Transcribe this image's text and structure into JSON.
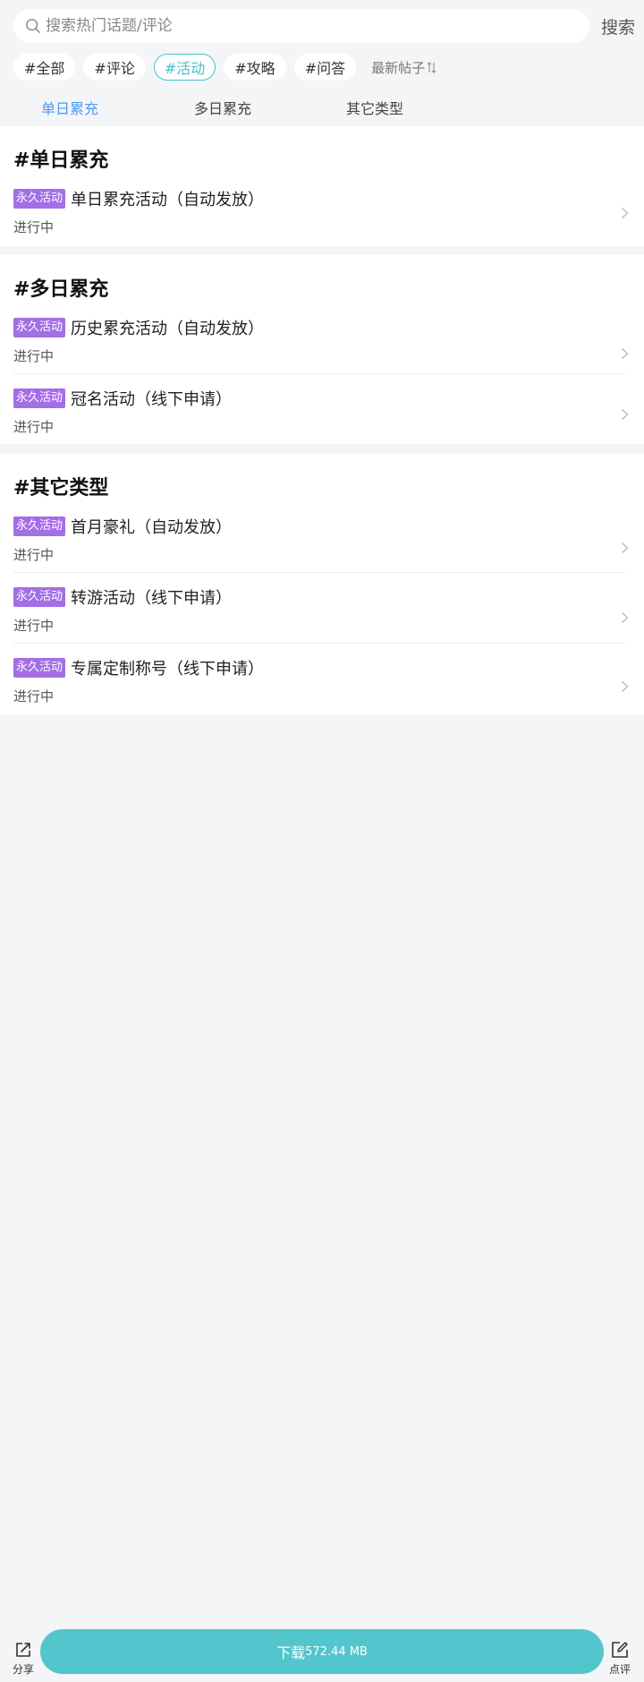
{
  "search": {
    "placeholder": "搜索热门话题/评论",
    "button_label": "搜索"
  },
  "filters": {
    "tags": [
      "#全部",
      "#评论",
      "#活动",
      "#攻略",
      "#问答"
    ],
    "active_tag": "#活动",
    "sort_label": "最新帖子"
  },
  "tabs": [
    {
      "label": "单日累充",
      "active": true
    },
    {
      "label": "多日累充",
      "active": false
    },
    {
      "label": "其它类型",
      "active": false
    }
  ],
  "sections": [
    {
      "title": "#单日累充",
      "items": [
        {
          "badge": "永久活动",
          "title": "单日累充活动（自动发放）",
          "status": "进行中"
        }
      ]
    },
    {
      "title": "#多日累充",
      "items": [
        {
          "badge": "永久活动",
          "title": "历史累充活动（自动发放）",
          "status": "进行中"
        },
        {
          "badge": "永久活动",
          "title": "冠名活动（线下申请）",
          "status": "进行中"
        }
      ]
    },
    {
      "title": "#其它类型",
      "items": [
        {
          "badge": "永久活动",
          "title": "首月豪礼（自动发放）",
          "status": "进行中"
        },
        {
          "badge": "永久活动",
          "title": "转游活动（线下申请）",
          "status": "进行中"
        },
        {
          "badge": "永久活动",
          "title": "专属定制称号（线下申请）",
          "status": "进行中"
        }
      ]
    }
  ],
  "bottom_bar": {
    "share_label": "分享",
    "download_label": "下载",
    "download_size": "572.44 MB",
    "review_label": "点评"
  },
  "colors": {
    "accent": "#53c5cc",
    "active_tag": "#49bfc9",
    "active_tab": "#4a9af5",
    "badge": "#a46ee6",
    "background": "#f4f5f7"
  }
}
